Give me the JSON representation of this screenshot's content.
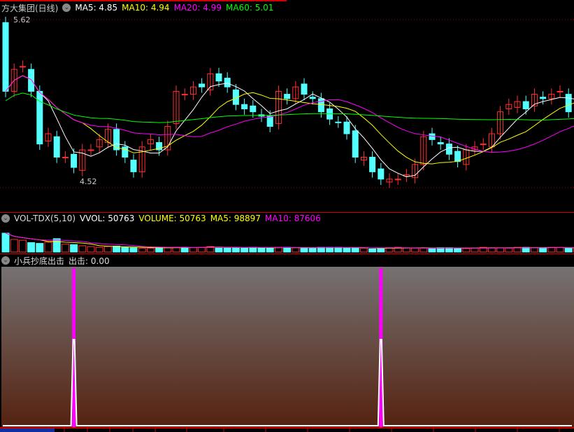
{
  "main": {
    "title": "方大集团(日线)",
    "ma5": "MA5: 4.85",
    "ma10": "MA10: 4.94",
    "ma20": "MA20: 4.99",
    "ma60": "MA60: 5.01",
    "high_label": "5.62",
    "low_label": "4.52"
  },
  "vol": {
    "title": "VOL-TDX(5,10)",
    "vvol": "VVOL: 50763",
    "volume": "VOLUME: 50763",
    "ma5": "MA5: 98897",
    "ma10": "MA10: 87606"
  },
  "ind": {
    "title": "小兵抄底出击",
    "value": "出击: 0.00"
  },
  "colors": {
    "up": "#ff3030",
    "down": "#54ffff",
    "ma5": "#ffffff",
    "ma10": "#ffff00",
    "ma20": "#ff00ff",
    "ma60": "#00ff00",
    "signal": "#ff00ff"
  },
  "chart_data": {
    "type": "candlestick",
    "price_range": [
      4.52,
      5.62
    ],
    "closes": [
      5.13,
      5.28,
      5.3,
      5.13,
      4.77,
      4.84,
      4.68,
      4.68,
      4.61,
      4.73,
      4.73,
      4.8,
      4.87,
      4.73,
      4.68,
      4.58,
      4.75,
      4.8,
      4.73,
      4.89,
      5.13,
      5.11,
      5.16,
      5.16,
      5.25,
      5.2,
      5.16,
      5.04,
      5.01,
      4.99,
      4.96,
      4.89,
      5.13,
      5.08,
      5.16,
      5.11,
      5.08,
      4.99,
      4.94,
      4.92,
      4.84,
      4.68,
      4.68,
      4.58,
      4.53,
      4.53,
      4.53,
      4.56,
      4.63,
      4.82,
      4.8,
      4.77,
      4.7,
      4.65,
      4.73,
      4.75,
      4.77,
      4.84,
      4.99,
      5.04,
      5.06,
      5.01,
      5.11,
      5.08,
      5.11,
      5.13,
      4.99,
      5.06
    ],
    "first_open": 5.6,
    "volumes": [
      240,
      160,
      150,
      120,
      110,
      125,
      170,
      100,
      95,
      80,
      70,
      60,
      70,
      75,
      60,
      55,
      50,
      50,
      60,
      55,
      60,
      60,
      55,
      60,
      70,
      60,
      55,
      55,
      50,
      60,
      55,
      55,
      60,
      60,
      55,
      55,
      50,
      60,
      60,
      60,
      55,
      55,
      50,
      40,
      45,
      55,
      60,
      55,
      50,
      50,
      45,
      55,
      55,
      50,
      45,
      50,
      60,
      55,
      55,
      50,
      60,
      60,
      55,
      55,
      60,
      60,
      50,
      50
    ],
    "signal_indices": [
      8,
      44
    ]
  }
}
